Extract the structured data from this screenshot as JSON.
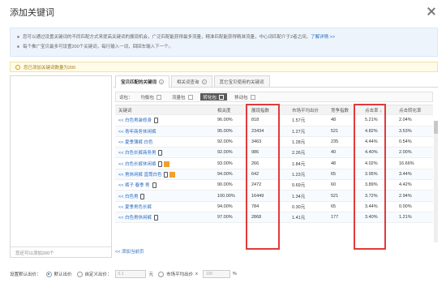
{
  "dialog": {
    "title": "添加关键词"
  },
  "notice": {
    "line1": "您可以通过设置关键词的不同匹配方式来提高关键词的展现机会，广泛匹配能获得最多流量，精准匹配能获得精准流量，中心词匹配介于2者之间，",
    "line1_link": "了解详情 >>",
    "line2": "每个推广宝贝最多可设置200个关键词，每行输入一词，回回车输入下一个。"
  },
  "countbar": {
    "text": "您已添加关键词数量为200"
  },
  "leftpanel": {
    "footer": "您还可以添加200个"
  },
  "tabs": [
    {
      "label": "宝贝匹配的关键词",
      "active": true
    },
    {
      "label": "相关词查询",
      "active": false
    },
    {
      "label": "其它宝贝使用的关键词",
      "active": false
    }
  ],
  "filters": {
    "label": "词包：",
    "chips": [
      {
        "label": "均衡包",
        "selected": false
      },
      {
        "label": "流量包",
        "selected": false
      },
      {
        "label": "转化包",
        "selected": true
      },
      {
        "label": "移动包",
        "selected": false
      }
    ]
  },
  "table": {
    "headers": {
      "keyword": "关键词",
      "relevance": "相关度",
      "show_index": "展现指数",
      "avg_price": "市场平均出价",
      "competition": "竞争指数",
      "ctr": "点击率",
      "cvr": "点击转化率"
    },
    "rows": [
      {
        "keyword": "<< 白色男装修身",
        "relevance": "96.00%",
        "show_index": "818",
        "avg_price": "1.57元",
        "competition": "48",
        "ctr": "5.21%",
        "cvr": "2.04%"
      },
      {
        "keyword": "<< 青年商务休闲裤",
        "relevance": "95.00%",
        "show_index": "23434",
        "avg_price": "1.27元",
        "competition": "521",
        "ctr": "4.82%",
        "cvr": "3.53%"
      },
      {
        "keyword": "<< 夏季薄裤 白色",
        "relevance": "92.00%",
        "show_index": "3463",
        "avg_price": "1.28元",
        "competition": "235",
        "ctr": "4.44%",
        "cvr": "0.54%"
      },
      {
        "keyword": "<< 白色长裤商务男",
        "relevance": "92.00%",
        "show_index": "986",
        "avg_price": "2.26元",
        "competition": "40",
        "ctr": "4.40%",
        "cvr": "2.00%"
      },
      {
        "keyword": "<< 白色长裤休闲裤",
        "relevance": "93.00%",
        "show_index": "266",
        "avg_price": "1.84元",
        "competition": "48",
        "ctr": "4.02%",
        "cvr": "16.66%"
      },
      {
        "keyword": "<< 男休闲裤 直筒白色",
        "relevance": "94.00%",
        "show_index": "642",
        "avg_price": "1.23元",
        "competition": "65",
        "ctr": "3.95%",
        "cvr": "3.44%"
      },
      {
        "keyword": "<< 裤子 春季 男",
        "relevance": "90.00%",
        "show_index": "2472",
        "avg_price": "0.69元",
        "competition": "60",
        "ctr": "3.89%",
        "cvr": "4.42%"
      },
      {
        "keyword": "<< 白色男",
        "relevance": "100.00%",
        "show_index": "16449",
        "avg_price": "1.34元",
        "competition": "521",
        "ctr": "3.72%",
        "cvr": "2.94%"
      },
      {
        "keyword": "<< 夏季男色长裤",
        "relevance": "94.00%",
        "show_index": "784",
        "avg_price": "0.30元",
        "competition": "65",
        "ctr": "3.44%",
        "cvr": "0.00%"
      },
      {
        "keyword": "<< 白色男休闲裤",
        "relevance": "97.00%",
        "show_index": "2868",
        "avg_price": "1.41元",
        "competition": "177",
        "ctr": "3.40%",
        "cvr": "1.21%"
      }
    ]
  },
  "add_all_link": "<< 添加当前页",
  "bottom": {
    "label": "设置默认出价：",
    "radio_default": "默认出价",
    "radio_custom": "自定义出价：",
    "price_value": "0.1",
    "unit": "元",
    "radio_market": "市场平均出价",
    "times": "x",
    "percent_value": "100",
    "percent": "%"
  },
  "colors": {
    "accent": "#2a6bc0",
    "highlight": "#e23a3a"
  }
}
